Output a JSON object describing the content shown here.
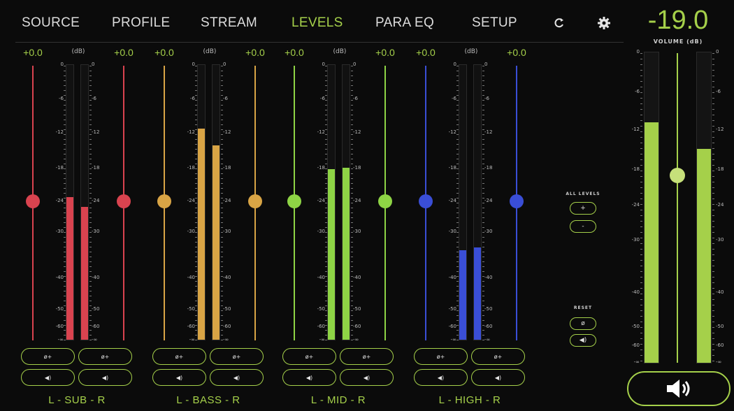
{
  "nav": {
    "tabs": [
      {
        "label": "SOURCE",
        "active": false
      },
      {
        "label": "PROFILE",
        "active": false
      },
      {
        "label": "STREAM",
        "active": false
      },
      {
        "label": "LEVELS",
        "active": true
      },
      {
        "label": "PARA EQ",
        "active": false
      },
      {
        "label": "SETUP",
        "active": false
      }
    ],
    "icons": [
      "refresh-icon",
      "gear-icon"
    ]
  },
  "accent": "#a5d04a",
  "db_unit": "(dB)",
  "scale_labels": [
    "0",
    "-6",
    "-12",
    "-18",
    "-24",
    "-30",
    "-40",
    "-50",
    "-60",
    "-∞"
  ],
  "groups": [
    {
      "name": "L - SUB - R",
      "color": "#d9434f",
      "left_gain": "+0.0",
      "right_gain": "+0.0",
      "left_level": -24,
      "right_level": -24,
      "meter_left": -23.5,
      "meter_right": -25.3,
      "btn_phase": "ø+",
      "btn_mute": "◀)"
    },
    {
      "name": "L - BASS - R",
      "color": "#d8a445",
      "left_gain": "+0.0",
      "right_gain": "+0.0",
      "left_level": -24,
      "right_level": -24,
      "meter_left": -11.5,
      "meter_right": -14.3,
      "btn_phase": "ø+",
      "btn_mute": "◀)"
    },
    {
      "name": "L - MID - R",
      "color": "#8ed445",
      "left_gain": "+0.0",
      "right_gain": "+0.0",
      "left_level": -24,
      "right_level": -24,
      "meter_left": -18.4,
      "meter_right": -18.1,
      "btn_phase": "ø+",
      "btn_mute": "◀)"
    },
    {
      "name": "L - HIGH - R",
      "color": "#3a4ed6",
      "left_gain": "+0.0",
      "right_gain": "+0.0",
      "left_level": -24,
      "right_level": -24,
      "meter_left": -34.3,
      "meter_right": -33.6,
      "btn_phase": "ø+",
      "btn_mute": "◀)"
    }
  ],
  "all_levels": {
    "caption": "ALL LEVELS",
    "plus": "+",
    "minus": "-"
  },
  "reset": {
    "caption": "RESET",
    "phase": "ø",
    "mute": "◀)"
  },
  "volume": {
    "readout": "-19.0",
    "label": "VOLUME (dB)",
    "level": -19,
    "meter_left": -10.8,
    "meter_right": -14.8,
    "scale_labels": [
      "0",
      "-6",
      "-12",
      "-18",
      "-24",
      "-30",
      "-40",
      "-50",
      "-60",
      "-∞"
    ]
  }
}
